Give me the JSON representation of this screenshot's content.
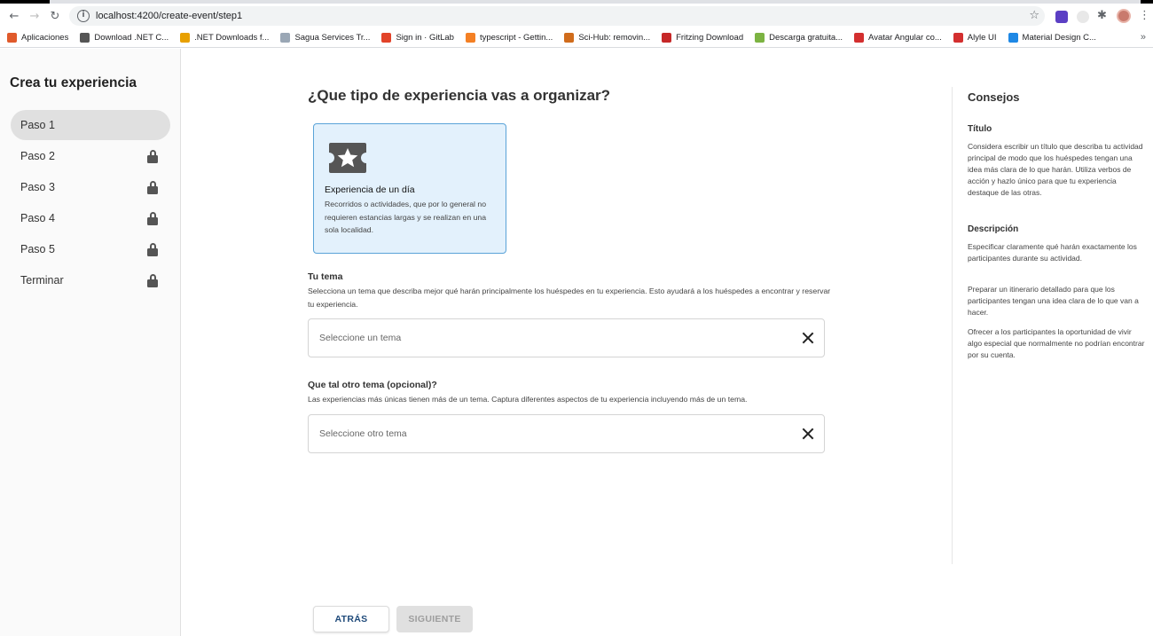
{
  "browser": {
    "url": "localhost:4200/create-event/step1",
    "bookmarks": [
      {
        "label": "Aplicaciones",
        "color": "#e05a2b"
      },
      {
        "label": "Download .NET C...",
        "color": "#555555"
      },
      {
        "label": ".NET Downloads f...",
        "color": "#e8a000"
      },
      {
        "label": "Sagua Services Tr...",
        "color": "#9aa7b5"
      },
      {
        "label": "Sign in · GitLab",
        "color": "#e24329"
      },
      {
        "label": "typescript - Gettin...",
        "color": "#f48024"
      },
      {
        "label": "Sci-Hub: removin...",
        "color": "#d06c1c"
      },
      {
        "label": "Fritzing Download",
        "color": "#c62828"
      },
      {
        "label": "Descarga gratuita...",
        "color": "#7cb342"
      },
      {
        "label": "Avatar Angular co...",
        "color": "#d32f2f"
      },
      {
        "label": "Alyle UI",
        "color": "#d32f2f"
      },
      {
        "label": "Material Design C...",
        "color": "#1e88e5"
      }
    ]
  },
  "sidebar": {
    "title": "Crea tu experiencia",
    "steps": [
      {
        "label": "Paso 1",
        "locked": false,
        "active": true
      },
      {
        "label": "Paso 2",
        "locked": true,
        "active": false
      },
      {
        "label": "Paso 3",
        "locked": true,
        "active": false
      },
      {
        "label": "Paso 4",
        "locked": true,
        "active": false
      },
      {
        "label": "Paso 5",
        "locked": true,
        "active": false
      },
      {
        "label": "Terminar",
        "locked": true,
        "active": false
      }
    ]
  },
  "main": {
    "title": "¿Que tipo de experiencia vas a organizar?",
    "card": {
      "icon": "ticket-star-icon",
      "title": "Experiencia de un día",
      "description": "Recorridos o actividades, que por lo general no requieren estancias largas y se realizan en una sola localidad."
    },
    "theme": {
      "label": "Tu tema",
      "help": "Selecciona un tema que describa mejor qué harán principalmente los huéspedes en tu experiencia. Esto ayudará a los huéspedes a encontrar y reservar tu experiencia.",
      "placeholder": "Seleccione un tema"
    },
    "other_theme": {
      "label": "Que tal otro tema (opcional)?",
      "help": "Las experiencias más únicas tienen más de un tema. Captura diferentes aspectos de tu experiencia incluyendo más de un tema.",
      "placeholder": "Seleccione otro tema"
    },
    "buttons": {
      "back": "ATRÁS",
      "next": "SIGUIENTE"
    }
  },
  "tips": {
    "title": "Consejos",
    "title_heading": "Título",
    "title_text": "Considera escribir un título que describa tu actividad principal de modo que los huéspedes tengan una idea más clara de lo que harán. Utiliza verbos de acción y hazlo único para que tu experiencia destaque de las otras.",
    "description_heading": "Descripción",
    "description_points": [
      "Especificar claramente qué harán exactamente los participantes durante su actividad.",
      "Preparar un itinerario detallado para que los participantes tengan una idea clara de lo que van a hacer.",
      "Ofrecer a los participantes la oportunidad de vivir algo especial que normalmente no podrían encontrar por su cuenta."
    ]
  },
  "colors": {
    "card_bg": "#e3f1fc",
    "card_border": "#5aa3d8",
    "back_text": "#1f4a7a",
    "next_disabled_bg": "#e0e0e0"
  }
}
